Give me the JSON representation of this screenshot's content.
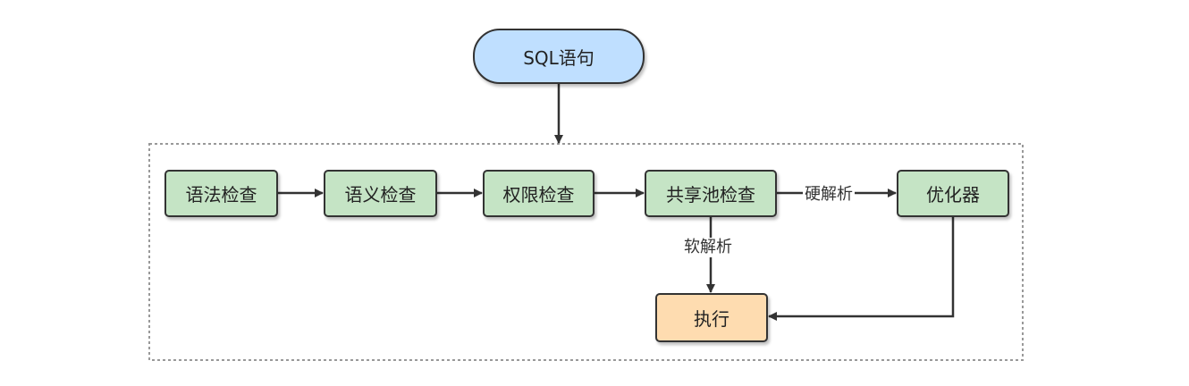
{
  "colors": {
    "start_fill": "#bfdfff",
    "check_fill": "#c5e4c5",
    "exec_fill": "#fedcb0",
    "stroke": "#333333"
  },
  "nodes": {
    "start": "SQL语句",
    "syntax_check": "语法检查",
    "semantic_check": "语义检查",
    "permission_check": "权限检查",
    "shared_pool_check": "共享池检查",
    "optimizer": "优化器",
    "execute": "执行"
  },
  "edges": {
    "hard_parse": "硬解析",
    "soft_parse": "软解析"
  }
}
